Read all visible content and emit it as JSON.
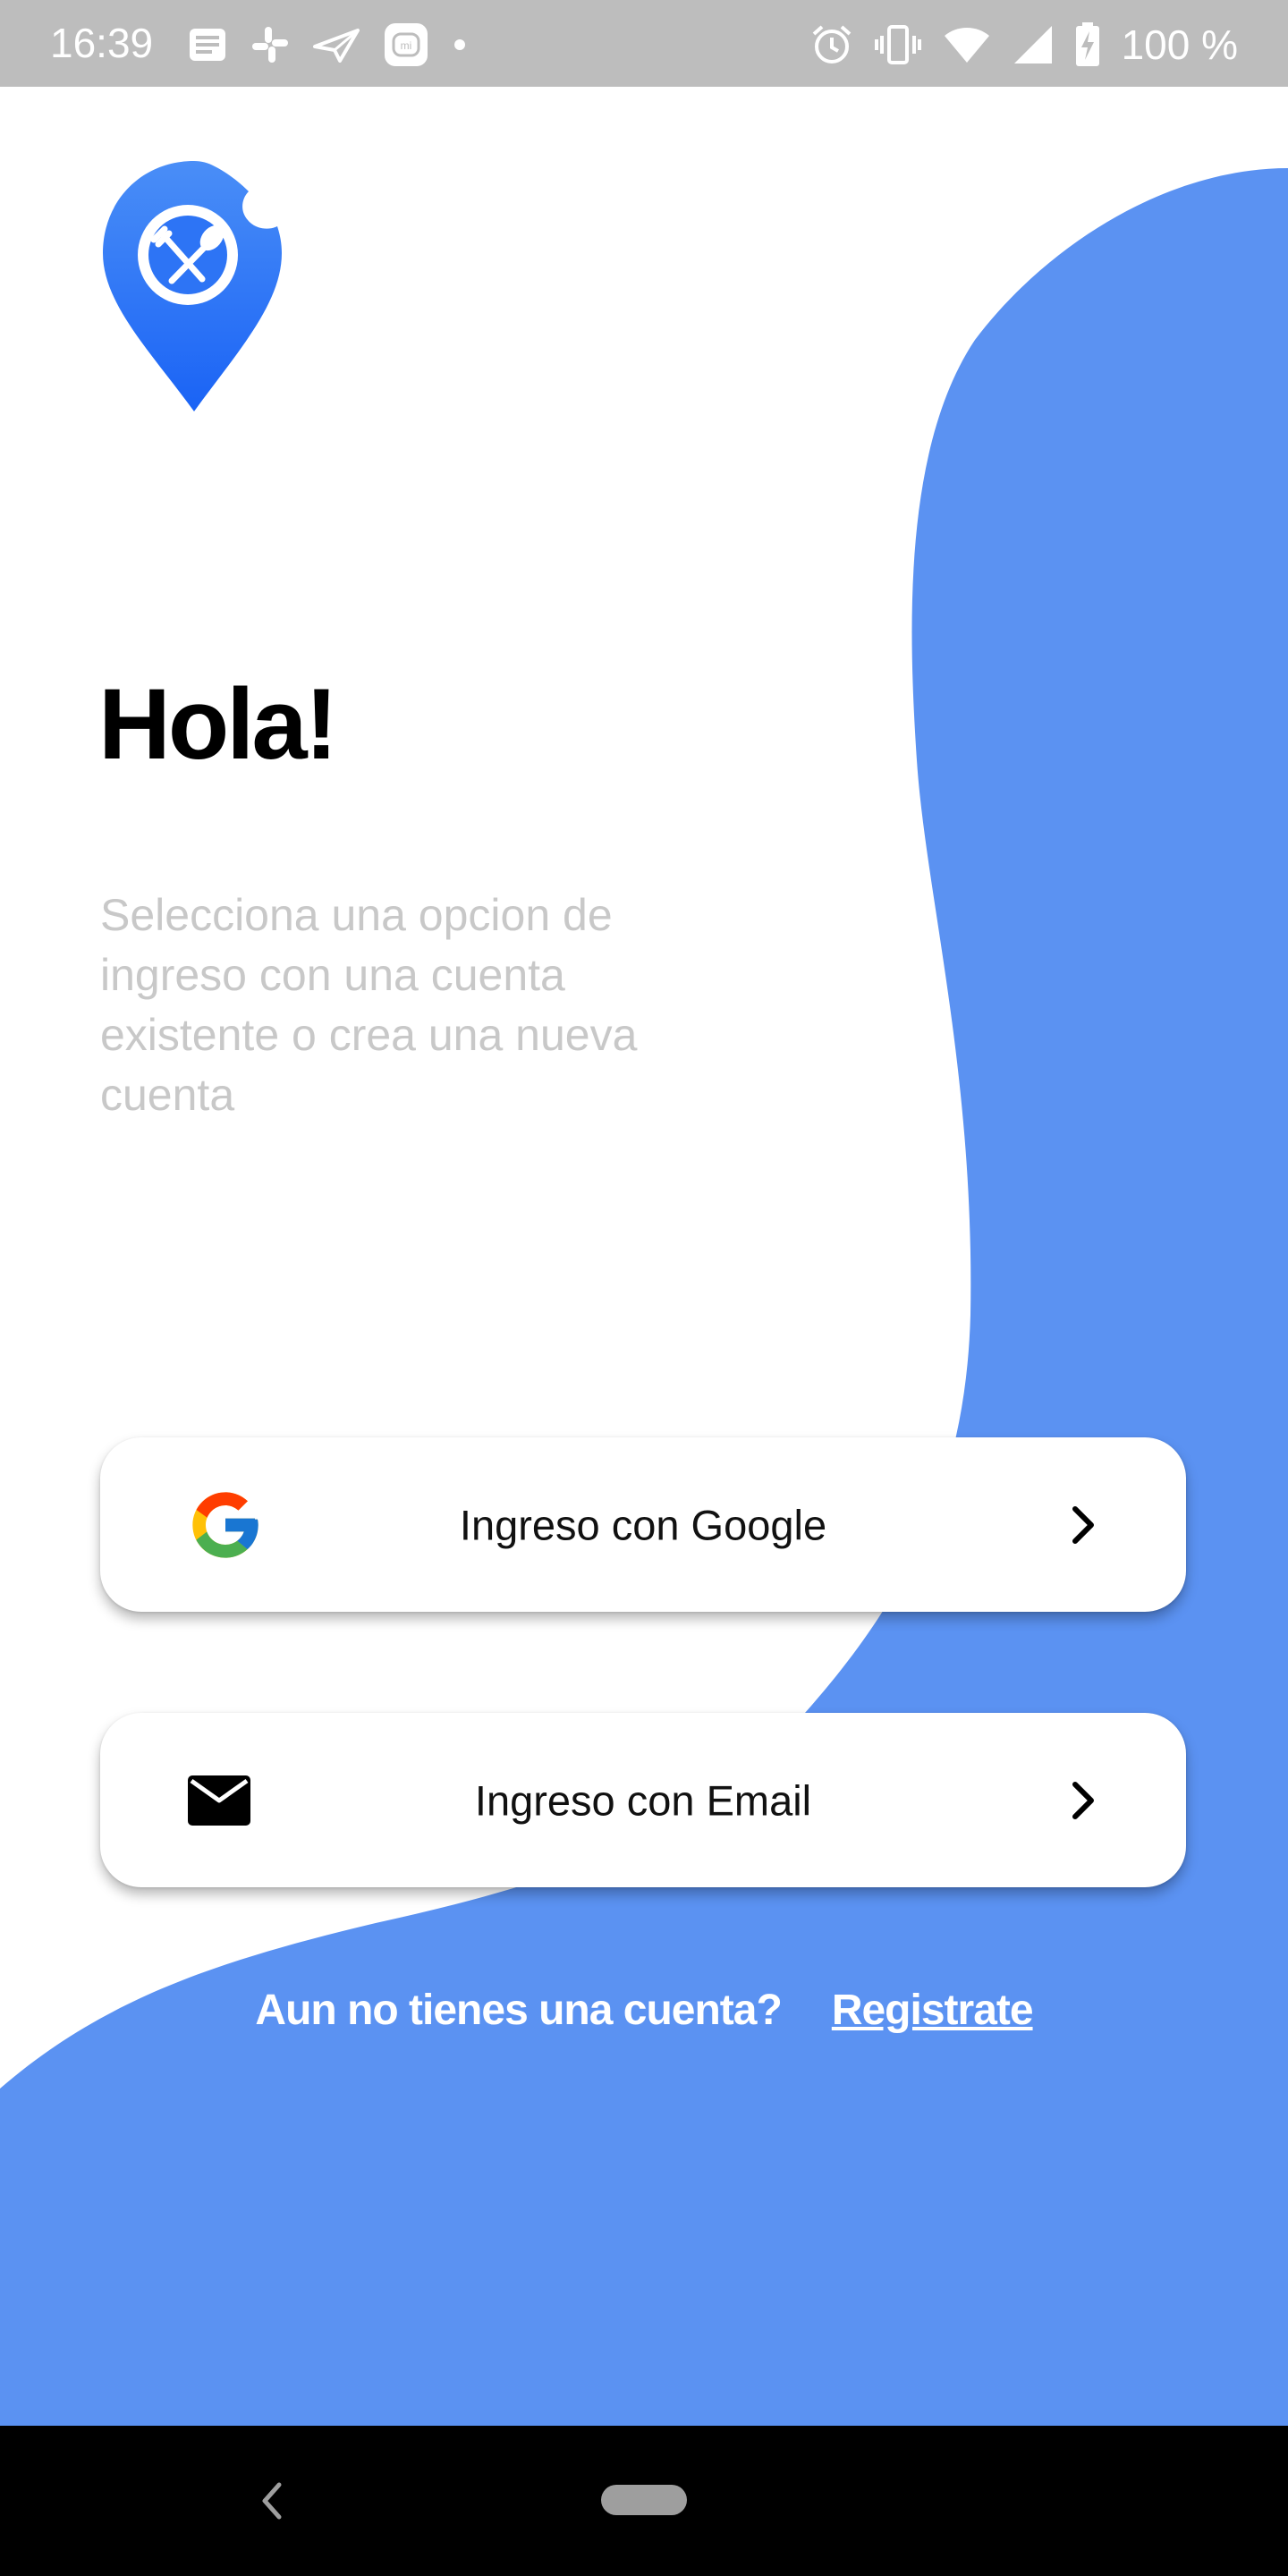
{
  "status_bar": {
    "time": "16:39",
    "battery": "100 %",
    "left_icons": [
      "notes-icon",
      "slack-icon",
      "send-icon",
      "mi-icon",
      "dot-icon"
    ],
    "right_icons": [
      "alarm-icon",
      "vibrate-icon",
      "wifi-icon",
      "signal-icon",
      "battery-charging-icon"
    ]
  },
  "colors": {
    "accent_blue": "#5b92f2",
    "logo_blue": "#2d74f5",
    "subtitle_gray": "#c8c8c8"
  },
  "main": {
    "headline": "Hola!",
    "subtitle": "Selecciona una opcion de ingreso con una cuenta existente o crea una nueva cuenta"
  },
  "buttons": {
    "google_label": "Ingreso con Google",
    "email_label": "Ingreso con Email"
  },
  "register": {
    "question": "Aun no tienes una cuenta?",
    "link": "Registrate"
  }
}
